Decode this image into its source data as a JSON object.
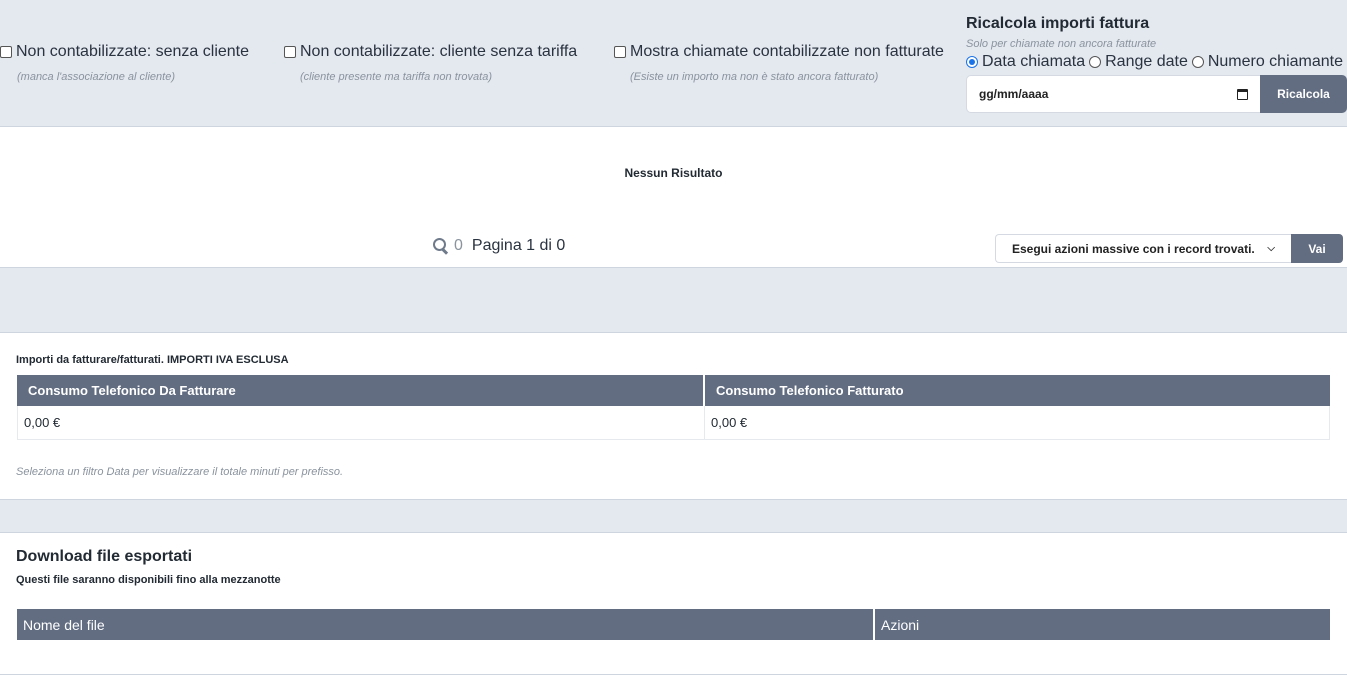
{
  "filters": {
    "unbilled_no_client": {
      "label": "Non contabilizzate: senza cliente",
      "hint": "(manca l'associazione al cliente)",
      "checked": false
    },
    "unbilled_no_rate": {
      "label": "Non contabilizzate: cliente senza tariffa",
      "hint": "(cliente presente ma tariffa non trovata)",
      "checked": false
    },
    "show_uninvoiced": {
      "label": "Mostra chiamate contabilizzate non fatturate",
      "hint": "(Esiste un importo ma non è stato ancora fatturato)",
      "checked": false
    }
  },
  "recalc": {
    "title": "Ricalcola importi fattura",
    "subtitle": "Solo per chiamate non ancora fatturate",
    "radio_options": [
      "Data chiamata",
      "Range date",
      "Numero chiamante"
    ],
    "selected_option": "Data chiamata",
    "date_placeholder": "gg/mm/aaaa",
    "button_label": "Ricalcola"
  },
  "results": {
    "empty_message": "Nessun Risultato",
    "count": "0",
    "page_text": "Pagina 1 di 0",
    "mass_action_label": "Esegui azioni massive con i record trovati.",
    "go_button": "Vai"
  },
  "amounts": {
    "title": "Importi da fatturare/fatturati. IMPORTI IVA ESCLUSA",
    "columns": [
      "Consumo Telefonico Da Fatturare",
      "Consumo Telefonico Fatturato"
    ],
    "values": [
      "0,00 €",
      "0,00 €"
    ],
    "note": "Seleziona un filtro Data per visualizzare il totale minuti per prefisso."
  },
  "downloads": {
    "title": "Download file esportati",
    "subtitle": "Questi file saranno disponibili fino alla mezzanotte",
    "columns": [
      "Nome del file",
      "Azioni"
    ]
  },
  "colors": {
    "header_bg": "#626d82",
    "band_bg": "#e4e8ef",
    "radio_accent": "#1a73e8"
  }
}
